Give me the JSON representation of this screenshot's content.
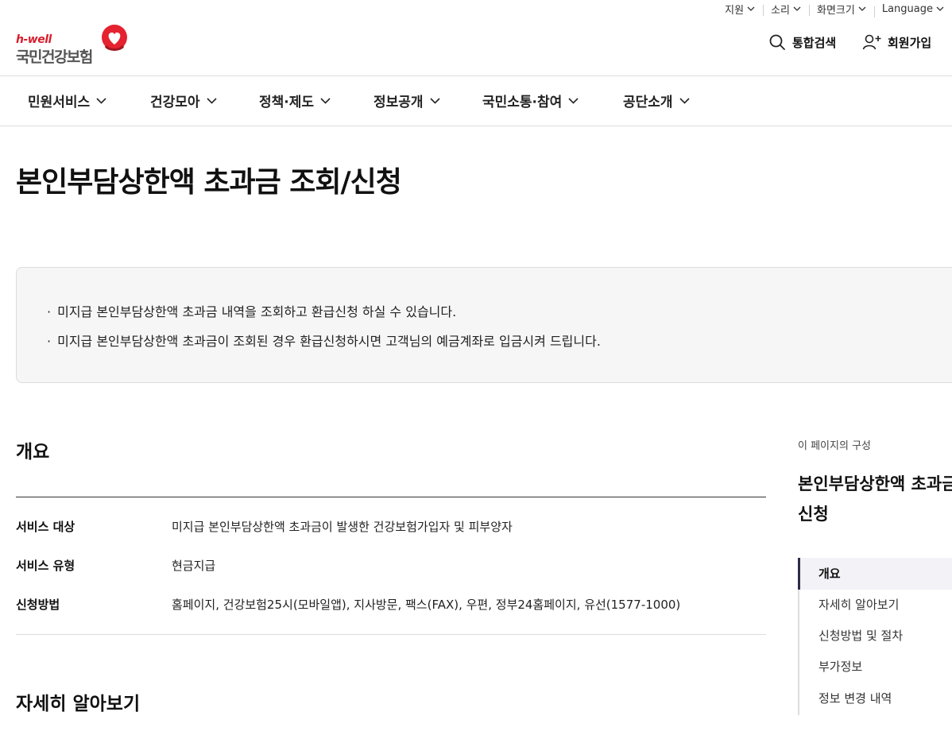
{
  "utility_bar": {
    "items": [
      {
        "label": "지원"
      },
      {
        "label": "소리"
      },
      {
        "label": "화면크기"
      },
      {
        "label": "Language"
      }
    ]
  },
  "header": {
    "logo_tagline": "h-well",
    "logo_name": "국민건강보험",
    "search_label": "통합검색",
    "signup_label": "회원가입",
    "brand_color": "#d81e2c"
  },
  "gnb": {
    "items": [
      {
        "label": "민원서비스"
      },
      {
        "label": "건강모아"
      },
      {
        "label": "정책·제도"
      },
      {
        "label": "정보공개"
      },
      {
        "label": "국민소통·참여"
      },
      {
        "label": "공단소개"
      }
    ]
  },
  "page": {
    "title": "본인부담상한액 초과금 조회/신청"
  },
  "info_box": {
    "bullet": "·",
    "lines": [
      "미지급 본인부담상한액 초과금 내역을 조회하고 환급신청 하실 수 있습니다.",
      "미지급 본인부담상한액 초과금이 조회된 경우 환급신청하시면 고객님의 예금계좌로 입금시켜 드립니다."
    ]
  },
  "overview": {
    "title": "개요",
    "rows": [
      {
        "label": "서비스 대상",
        "value": "미지급 본인부담상한액 초과금이 발생한 건강보험가입자 및 피부양자"
      },
      {
        "label": "서비스 유형",
        "value": "현금지급"
      },
      {
        "label": "신청방법",
        "value": "홈페이지, 건강보험25시(모바일앱), 지사방문, 팩스(FAX), 우편, 정부24홈페이지, 유선(1577-1000)"
      }
    ]
  },
  "details": {
    "title": "자세히 알아보기"
  },
  "sidebar": {
    "caption": "이 페이지의 구성",
    "title_line1": "본인부담상한액 초과금 조회/",
    "title_line2": "신청",
    "nav": [
      {
        "label": "개요",
        "active": true
      },
      {
        "label": "자세히 알아보기",
        "active": false
      },
      {
        "label": "신청방법 및 절차",
        "active": false
      },
      {
        "label": "부가정보",
        "active": false
      },
      {
        "label": "정보 변경 내역",
        "active": false
      }
    ]
  }
}
